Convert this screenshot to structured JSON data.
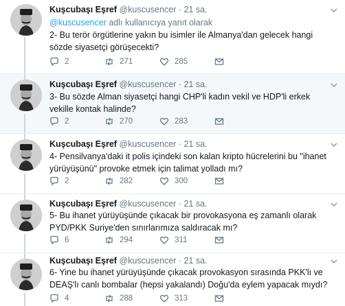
{
  "author": {
    "name": "Kuşcubaşı Eşref",
    "handle": "@kuscusencer",
    "separator": "·"
  },
  "reply_context": {
    "mention": "@kuscusencer",
    "text": " adlı kullanıcıya yanıt olarak"
  },
  "tweets": [
    {
      "time": "21 sa.",
      "text": "2- Bu terör örgütlerine yakın bu isimler ile Almanya'dan gelecek hangi sözde siyasetçi görüşecekti?",
      "replies": "2",
      "retweets": "271",
      "likes": "285"
    },
    {
      "time": "21 sa.",
      "text": "3- Bu sözde Alman siyasetçi hangi CHP'li kadın vekil ve HDP'li erkek vekille kontak halinde?",
      "replies": "2",
      "retweets": "270",
      "likes": "283"
    },
    {
      "time": "21 sa.",
      "text": "4- Pensilvanya'daki it polis içindeki son kalan kripto hücrelerini bu \"ihanet yürüyüşünü\" provoke etmek için talimat yolladı mı?",
      "replies": "2",
      "retweets": "282",
      "likes": "300"
    },
    {
      "time": "21 sa.",
      "text": "5- Bu ihanet yürüyüşünde çıkacak bir provokasyona eş zamanlı olarak PYD/PKK Suriye'den sınırlarımıza saldıracak mı?",
      "replies": "6",
      "retweets": "294",
      "likes": "311"
    },
    {
      "time": "21 sa.",
      "text": "6- Yine bu ihanet yürüyüşünde çıkacak provokasyon sırasında PKK'lı ve DEAŞ'lı canlı bombalar (hepsi yakalandı) Doğu'da eylem yapacak mıydı?",
      "replies": "4",
      "retweets": "288",
      "likes": "313"
    }
  ],
  "colors": {
    "link": "#1da1f2",
    "muted": "#657786",
    "thread_line": "#ccd6dd",
    "highlight_bg": "#f5f8fa"
  }
}
